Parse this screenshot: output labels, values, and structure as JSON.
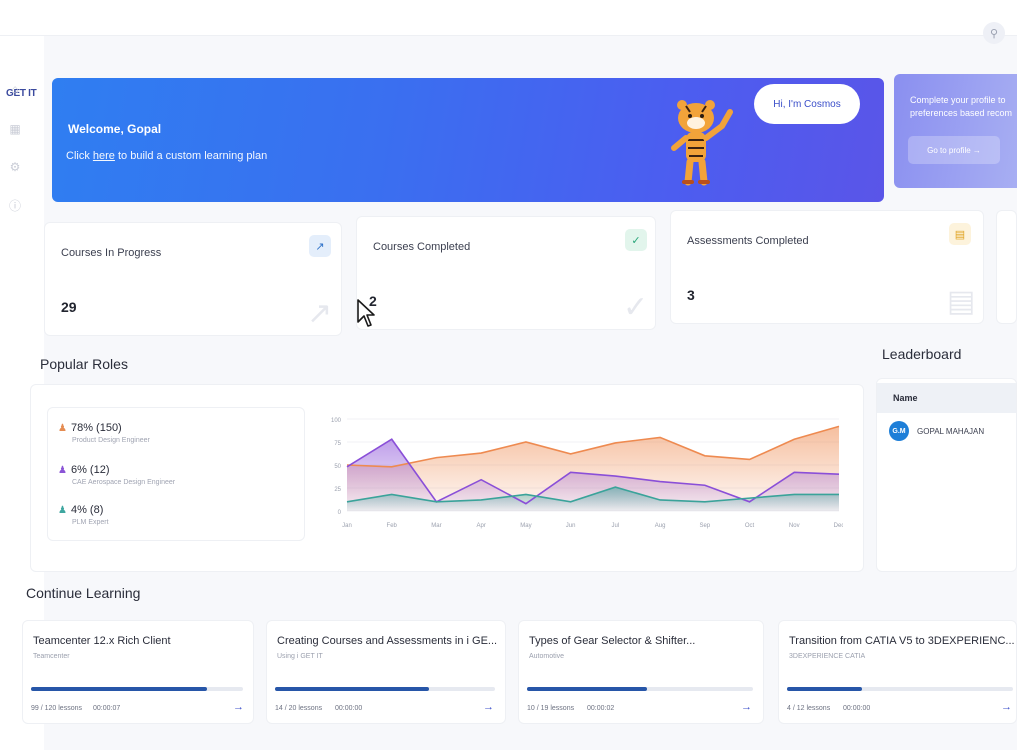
{
  "app": {
    "logo": "GET IT"
  },
  "icons": {
    "search": "search-icon",
    "home": "home-icon",
    "book": "book-icon",
    "gear": "gear-icon",
    "help": "help-icon"
  },
  "welcome": {
    "title": "Welcome, Gopal",
    "sub_prefix": "Click ",
    "sub_link": "here",
    "sub_suffix": " to build a custom learning plan",
    "bubble": "Hi, I'm Cosmos"
  },
  "profile": {
    "text": "Complete your profile to preferences based recom",
    "button": "Go to profile →"
  },
  "stats": [
    {
      "label": "Courses In Progress",
      "value": "29",
      "icon": "trend-icon",
      "color": "#2f72c9"
    },
    {
      "label": "Courses Completed",
      "value": "2",
      "icon": "check-circle-icon",
      "color": "#2aa67a"
    },
    {
      "label": "Assessments Completed",
      "value": "3",
      "icon": "scroll-icon",
      "color": "#e0a21e"
    }
  ],
  "popular_roles": {
    "title": "Popular Roles",
    "roles": [
      {
        "pct": "78% (150)",
        "name": "Product Design Engineer",
        "color": "#e58c52"
      },
      {
        "pct": "6% (12)",
        "name": "CAE Aerospace Design Engineer",
        "color": "#8b55d6"
      },
      {
        "pct": "4% (8)",
        "name": "PLM Expert",
        "color": "#3fa7a0"
      }
    ]
  },
  "chart_data": {
    "type": "area",
    "categories": [
      "Jan",
      "Feb",
      "Mar",
      "Apr",
      "May",
      "Jun",
      "Jul",
      "Aug",
      "Sep",
      "Oct",
      "Nov",
      "Dec"
    ],
    "yticks": [
      0,
      25,
      50,
      75,
      100
    ],
    "ylim": [
      0,
      100
    ],
    "series": [
      {
        "values": [
          50,
          48,
          58,
          63,
          75,
          62,
          74,
          80,
          60,
          56,
          78,
          92
        ],
        "color": "#ee8a50"
      },
      {
        "values": [
          48,
          78,
          10,
          34,
          8,
          42,
          38,
          32,
          28,
          10,
          42,
          40
        ],
        "color": "#8a4fd8"
      },
      {
        "values": [
          10,
          18,
          10,
          12,
          18,
          10,
          26,
          12,
          10,
          14,
          18,
          18
        ],
        "color": "#3aa39a"
      }
    ]
  },
  "leaderboard": {
    "title": "Leaderboard",
    "column": "Name",
    "rows": [
      {
        "initials": "G.M",
        "name": "GOPAL MAHAJAN"
      }
    ]
  },
  "continue_learning": {
    "title": "Continue Learning",
    "courses": [
      {
        "title": "Teamcenter 12.x Rich Client",
        "category": "Teamcenter",
        "lessons": "99 / 120 lessons",
        "time": "00:00:07",
        "progress": 0.83
      },
      {
        "title": "Creating Courses and Assessments in i GE...",
        "category": "Using i GET IT",
        "lessons": "14 / 20 lessons",
        "time": "00:00:00",
        "progress": 0.7
      },
      {
        "title": "Types of Gear Selector & Shifter...",
        "category": "Automotive",
        "lessons": "10 / 19 lessons",
        "time": "00:00:02",
        "progress": 0.53
      },
      {
        "title": "Transition from CATIA V5 to 3DEXPERIENC...",
        "category": "3DEXPERIENCE CATIA",
        "lessons": "4 / 12 lessons",
        "time": "00:00:00",
        "progress": 0.33
      }
    ]
  }
}
